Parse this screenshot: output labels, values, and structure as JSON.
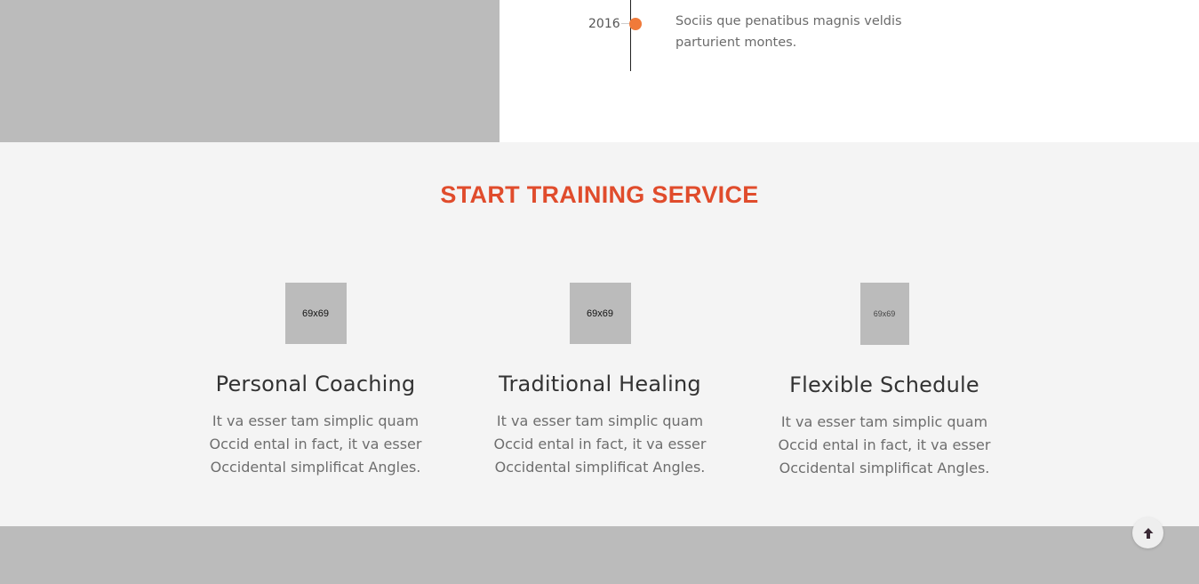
{
  "timeline": {
    "year": "2016",
    "text": "Sociis que penatibus magnis veldis parturient montes."
  },
  "services": {
    "title": "START TRAINING SERVICE",
    "items": [
      {
        "thumb_label": "69x69",
        "title": "Personal Coaching",
        "text": "It va esser tam simplic quam Occid ental in fact, it va esser Occidental simplificat Angles."
      },
      {
        "thumb_label": "69x69",
        "title": "Traditional Healing",
        "text": "It va esser tam simplic quam Occid ental in fact, it va esser Occidental simplificat Angles."
      },
      {
        "thumb_label": "69x69",
        "title": "Flexible Schedule",
        "text": "It va esser tam simplic quam Occid ental in fact, it va esser Occidental simplificat Angles."
      }
    ]
  },
  "colors": {
    "accent": "#e04c2c",
    "timeline_dot": "#f07a3a",
    "placeholder": "#bbbbbb",
    "section_bg": "#f4f4f4"
  },
  "icons": {
    "scroll_top": "arrow-up-icon"
  }
}
